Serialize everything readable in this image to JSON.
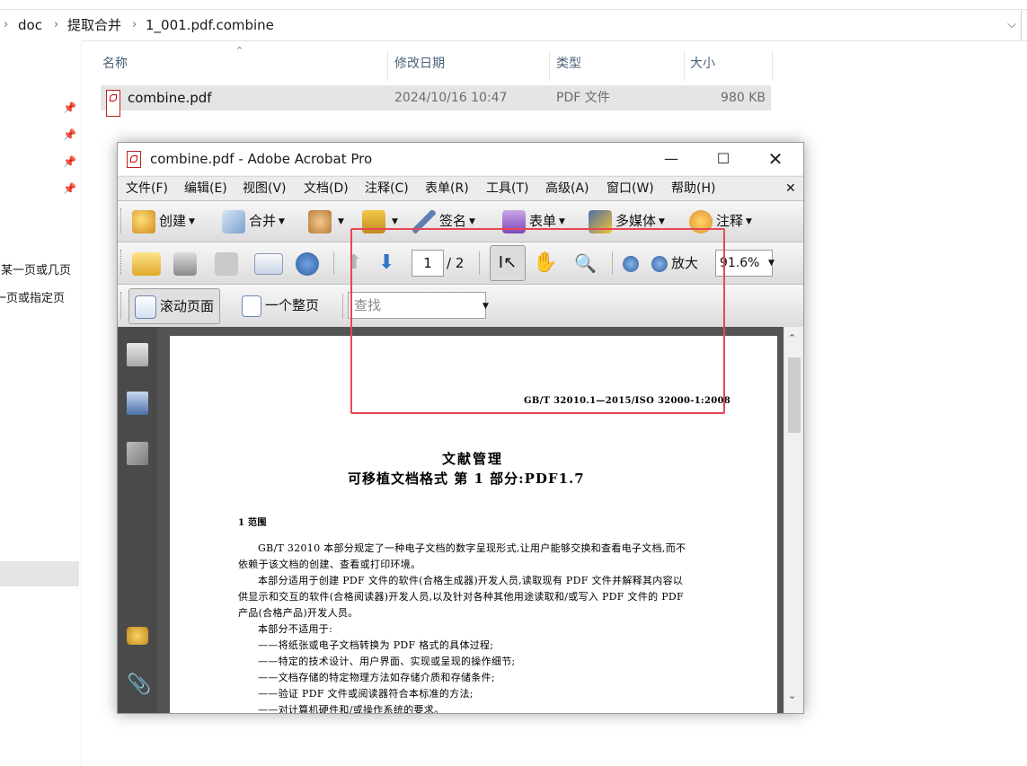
{
  "explorer": {
    "breadcrumb": [
      "doc",
      "提取合并",
      "1_001.pdf.combine"
    ],
    "columns": {
      "name": "名称",
      "modified": "修改日期",
      "type": "类型",
      "size": "大小"
    },
    "files": [
      {
        "name": "combine.pdf",
        "modified": "2024/10/16 10:47",
        "type": "PDF 文件",
        "size": "980 KB"
      }
    ],
    "nav_text": [
      "中某一页或几页",
      "一页或指定页"
    ]
  },
  "acrobat": {
    "title": "combine.pdf - Adobe Acrobat Pro",
    "menus": [
      "文件(F)",
      "编辑(E)",
      "视图(V)",
      "文档(D)",
      "注释(C)",
      "表单(R)",
      "工具(T)",
      "高级(A)",
      "窗口(W)",
      "帮助(H)"
    ],
    "toolbar1": {
      "create": "创建",
      "combine": "合并",
      "sign": "签名",
      "forms": "表单",
      "multimedia": "多媒体",
      "comment": "注释"
    },
    "toolbar2": {
      "current_page": "1",
      "page_total": "/ 2",
      "zoom_in": "放大",
      "zoom_value": "91.6%"
    },
    "toolbar3": {
      "scrolling": "滚动页面",
      "single_page": "一个整页",
      "find_placeholder": "查找"
    },
    "document": {
      "header_code": "GB/T  32010.1—2015/ISO 32000-1:2008",
      "title1": "文献管理",
      "title2": "可移植文档格式    第 1 部分:PDF1.7",
      "section": "1   范围",
      "lines": [
        "GB/T 32010 本部分规定了一种电子文档的数字呈现形式,让用户能够交换和查看电子文档,而不",
        "依赖于该文档的创建、查看或打印环境。",
        "本部分适用于创建 PDF 文件的软件(合格生成器)开发人员,读取现有 PDF 文件并解释其内容以",
        "供显示和交互的软件(合格阅读器)开发人员,以及针对各种其他用途读取和/或写入 PDF 文件的 PDF",
        "产品(合格产品)开发人员。",
        "本部分不适用于:",
        "——将纸张或电子文档转换为 PDF 格式的具体过程;",
        "——特定的技术设计、用户界面、实现或呈现的操作细节;",
        "——文档存储的特定物理方法如存储介质和存储条件;",
        "——验证 PDF 文件或阅读器符合本标准的方法;",
        "——对计算机硬件和/或操作系统的要求。"
      ]
    }
  },
  "colors": {
    "highlight": "#e84656",
    "selection": "#e5e5e5",
    "header_text": "#4c607a"
  }
}
